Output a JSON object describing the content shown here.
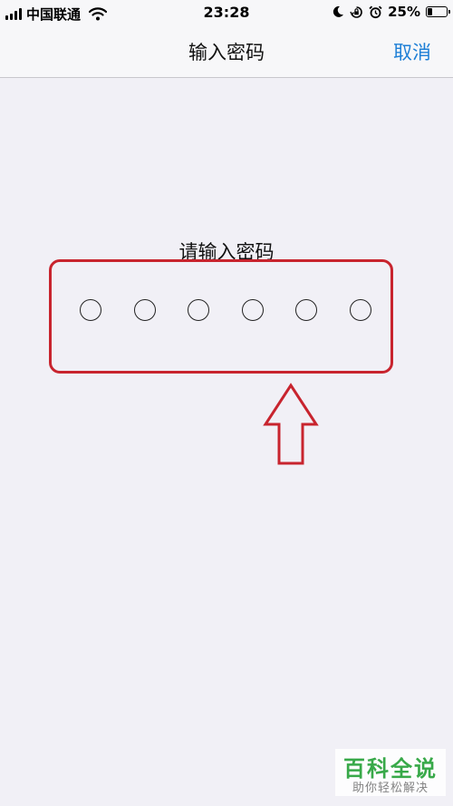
{
  "status_bar": {
    "carrier": "中国联通",
    "time": "23:28",
    "battery": "25%",
    "battery_level": 0.25
  },
  "nav": {
    "title": "输入密码",
    "cancel": "取消"
  },
  "passcode": {
    "prompt": "请输入密码",
    "digits": 6
  },
  "annotation": {
    "color": "#c8242e"
  },
  "watermark": {
    "main": "百科全说",
    "sub": "助你轻松解决"
  },
  "colors": {
    "accent": "#1e7fd6",
    "background": "#f1f0f6",
    "watermark": "#29a33b"
  }
}
